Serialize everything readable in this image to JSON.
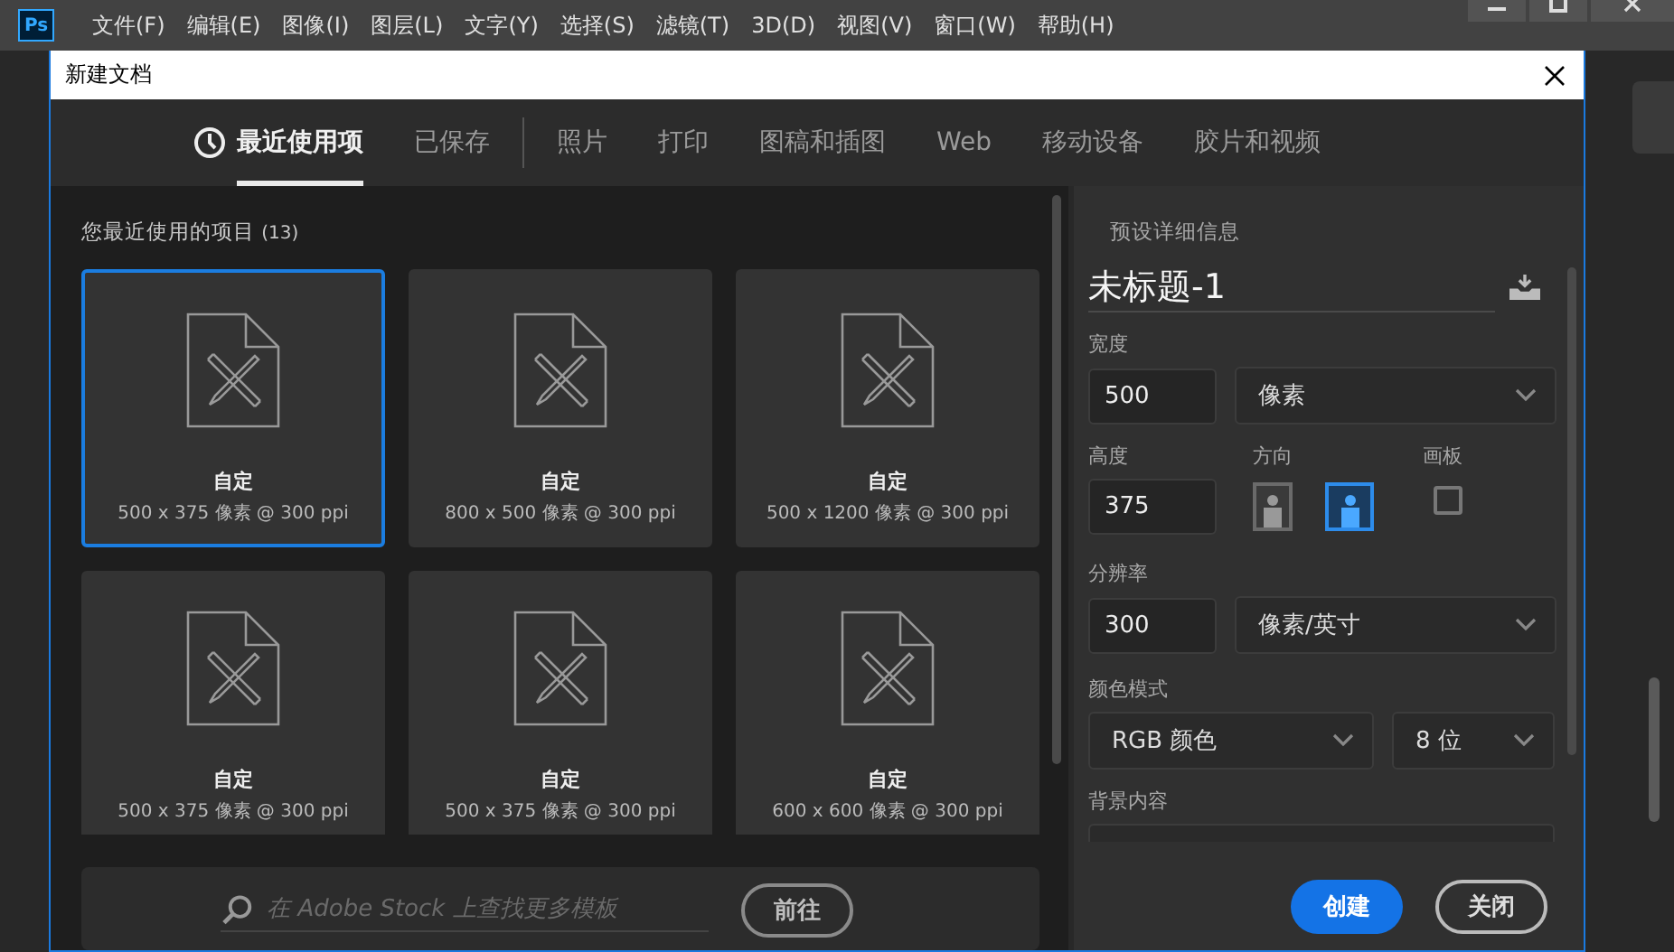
{
  "app": {
    "logo": "Ps",
    "menu": [
      "文件(F)",
      "编辑(E)",
      "图像(I)",
      "图层(L)",
      "文字(Y)",
      "选择(S)",
      "滤镜(T)",
      "3D(D)",
      "视图(V)",
      "窗口(W)",
      "帮助(H)"
    ]
  },
  "dialog": {
    "title": "新建文档",
    "tab_groups": [
      [
        {
          "label": "最近使用项",
          "selected": true,
          "kind": "recent"
        },
        {
          "label": "已保存",
          "selected": false,
          "kind": "plain"
        }
      ],
      [
        {
          "label": "照片",
          "selected": false
        },
        {
          "label": "打印",
          "selected": false
        },
        {
          "label": "图稿和插图",
          "selected": false
        },
        {
          "label": "Web",
          "selected": false
        },
        {
          "label": "移动设备",
          "selected": false
        },
        {
          "label": "胶片和视频",
          "selected": false
        }
      ]
    ],
    "recent": {
      "title": "您最近使用的项目",
      "count": "(13)",
      "items": [
        {
          "name": "自定",
          "size": "500 x 375 像素 @ 300 ppi",
          "selected": true
        },
        {
          "name": "自定",
          "size": "800 x 500 像素 @ 300 ppi",
          "selected": false
        },
        {
          "name": "自定",
          "size": "500 x 1200 像素 @ 300 ppi",
          "selected": false
        },
        {
          "name": "自定",
          "size": "500 x 375 像素 @ 300 ppi",
          "selected": false
        },
        {
          "name": "自定",
          "size": "500 x 375 像素 @ 300 ppi",
          "selected": false
        },
        {
          "name": "自定",
          "size": "600 x 600 像素 @ 300 ppi",
          "selected": false
        }
      ]
    },
    "search": {
      "placeholder": "在 Adobe Stock 上查找更多模板",
      "button": "前往"
    },
    "details": {
      "title": "预设详细信息",
      "doc_name": "未标题-1",
      "width": {
        "label": "宽度",
        "value": "500",
        "unit": "像素"
      },
      "height": {
        "label": "高度",
        "value": "375"
      },
      "orientation": {
        "label": "方向",
        "options": [
          {
            "kind": "portrait",
            "selected": false
          },
          {
            "kind": "landscape",
            "selected": true
          }
        ]
      },
      "artboard": {
        "label": "画板",
        "checked": false
      },
      "resolution": {
        "label": "分辨率",
        "value": "300",
        "unit": "像素/英寸"
      },
      "color_mode": {
        "label": "颜色模式",
        "mode": "RGB 颜色",
        "depth": "8 位"
      },
      "background": {
        "label": "背景内容"
      },
      "buttons": [
        {
          "label": "创建",
          "kind": "primary"
        },
        {
          "label": "关闭",
          "kind": "secondary"
        }
      ]
    }
  }
}
